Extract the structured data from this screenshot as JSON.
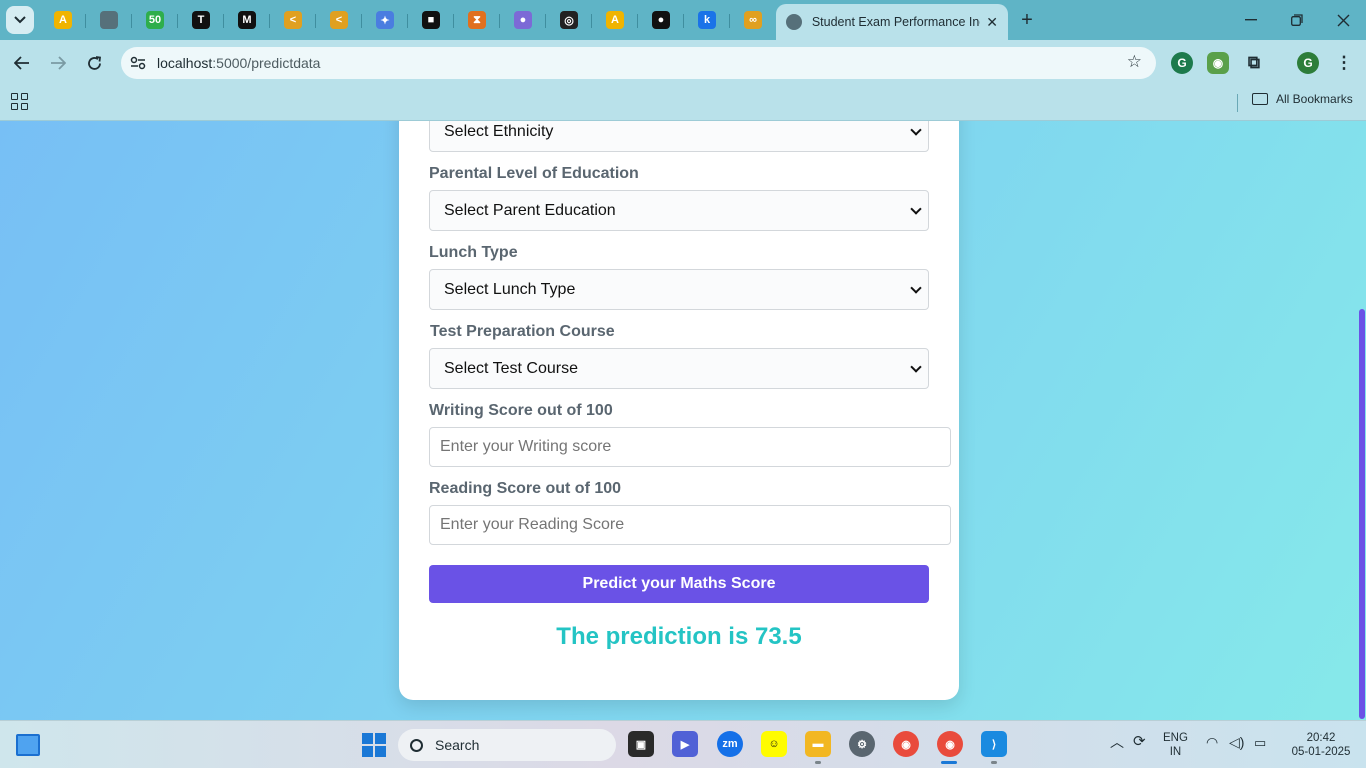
{
  "browser": {
    "pinned_tabs": [
      {
        "icon": "amazon-icon",
        "glyph": "A",
        "color": "#f0b400"
      },
      {
        "icon": "globe-icon",
        "glyph": "",
        "color": "#56707a"
      },
      {
        "icon": "fifty-icon",
        "glyph": "50",
        "color": "#2eae4c"
      },
      {
        "icon": "tradingview-icon",
        "glyph": "T",
        "color": "#111111"
      },
      {
        "icon": "medium-icon",
        "glyph": "M",
        "color": "#111111"
      },
      {
        "icon": "leaf-icon",
        "glyph": "<",
        "color": "#e0a020"
      },
      {
        "icon": "leaf-icon-2",
        "glyph": "<",
        "color": "#e0a020"
      },
      {
        "icon": "gemini-icon",
        "glyph": "✦",
        "color": "#4a7de0"
      },
      {
        "icon": "puzzle-icon",
        "glyph": "■",
        "color": "#111111"
      },
      {
        "icon": "hourglass-icon",
        "glyph": "⧗",
        "color": "#e0701f"
      },
      {
        "icon": "copilot-icon",
        "glyph": "●",
        "color": "#7c6ad6"
      },
      {
        "icon": "chatgpt-icon",
        "glyph": "◎",
        "color": "#222222"
      },
      {
        "icon": "amazon-icon-2",
        "glyph": "A",
        "color": "#f0b400"
      },
      {
        "icon": "github-icon",
        "glyph": "●",
        "color": "#111111"
      },
      {
        "icon": "k-icon",
        "glyph": "k",
        "color": "#1a73e8"
      },
      {
        "icon": "link-icon",
        "glyph": "∞",
        "color": "#e0a020"
      }
    ],
    "active_tab_title": "Student Exam Performance Indi",
    "url_host": "localhost",
    "url_path": ":5000/predictdata",
    "bookmarks_label": "All Bookmarks",
    "profile_initial": "G"
  },
  "form": {
    "ethnicity_select": "Select Ethnicity",
    "parent_education_label": "Parental Level of Education",
    "parent_education_select": "Select Parent Education",
    "lunch_label": "Lunch Type",
    "lunch_select": "Select Lunch Type",
    "test_prep_label": "Test Preparation Course",
    "test_prep_select": "Select Test Course",
    "writing_label": "Writing Score out of 100",
    "writing_placeholder": "Enter your Writing score",
    "reading_label": "Reading Score out of 100",
    "reading_placeholder": "Enter your Reading Score",
    "submit_label": "Predict your Maths Score",
    "prediction_text": "The prediction is 73.5",
    "accent_color": "#6a52e6",
    "prediction_color": "#24c4c4"
  },
  "taskbar": {
    "search_label": "Search",
    "lang_line1": "ENG",
    "lang_line2": "IN",
    "time": "20:42",
    "date": "05-01-2025"
  }
}
